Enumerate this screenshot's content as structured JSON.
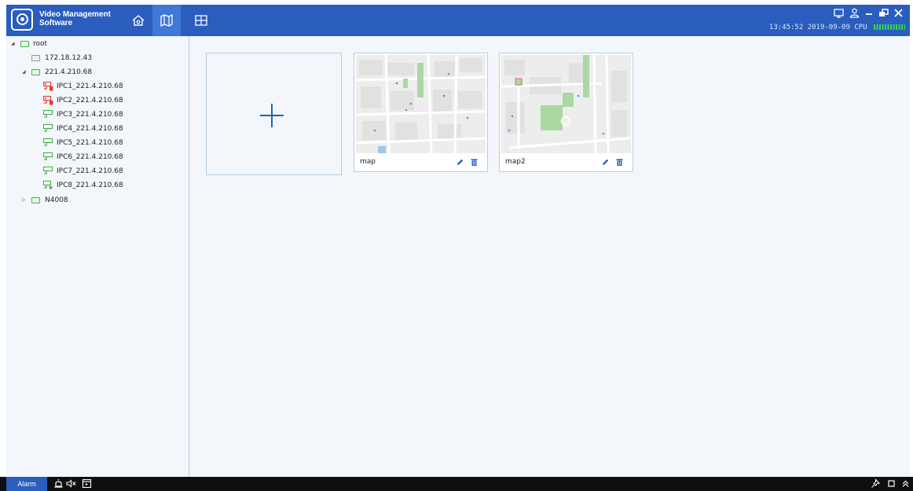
{
  "app": {
    "title_line1": "Video Management",
    "title_line2": "Software"
  },
  "header": {
    "nav": [
      {
        "icon": "home-icon",
        "active": false
      },
      {
        "icon": "map-icon",
        "active": true
      },
      {
        "icon": "grid-icon",
        "active": false
      }
    ],
    "window_controls": [
      "screen-icon",
      "user-icon",
      "minimize-icon",
      "restore-icon",
      "close-icon"
    ],
    "time": "13:45:52",
    "date": "2019-09-09",
    "cpu_label": "CPU"
  },
  "tree": {
    "root": {
      "label": "root",
      "expanded": true
    },
    "servers": [
      {
        "label": "172.18.12.43",
        "online": false
      },
      {
        "label": "221.4.210.68",
        "online": true,
        "expanded": true
      }
    ],
    "cameras": [
      {
        "label": "IPC1_221.4.210.68",
        "status": "alarm"
      },
      {
        "label": "IPC2_221.4.210.68",
        "status": "alarm"
      },
      {
        "label": "IPC3_221.4.210.68",
        "status": "online"
      },
      {
        "label": "IPC4_221.4.210.68",
        "status": "online"
      },
      {
        "label": "IPC5_221.4.210.68",
        "status": "online"
      },
      {
        "label": "IPC6_221.4.210.68",
        "status": "online"
      },
      {
        "label": "IPC7_221.4.210.68",
        "status": "online"
      },
      {
        "label": "IPC8_221.4.210.68",
        "status": "recording"
      }
    ],
    "nvr": {
      "label": "N4008",
      "expanded": false
    }
  },
  "maps": [
    {
      "name": "map"
    },
    {
      "name": "map2"
    }
  ],
  "bottom": {
    "alarm_tab": "Alarm"
  },
  "colors": {
    "header": "#2a5dbd",
    "active_nav": "#3f78d6",
    "panel": "#f3f6fa",
    "online": "#4caf50",
    "alarm": "#e53935",
    "cpu": "#2ce03a"
  }
}
